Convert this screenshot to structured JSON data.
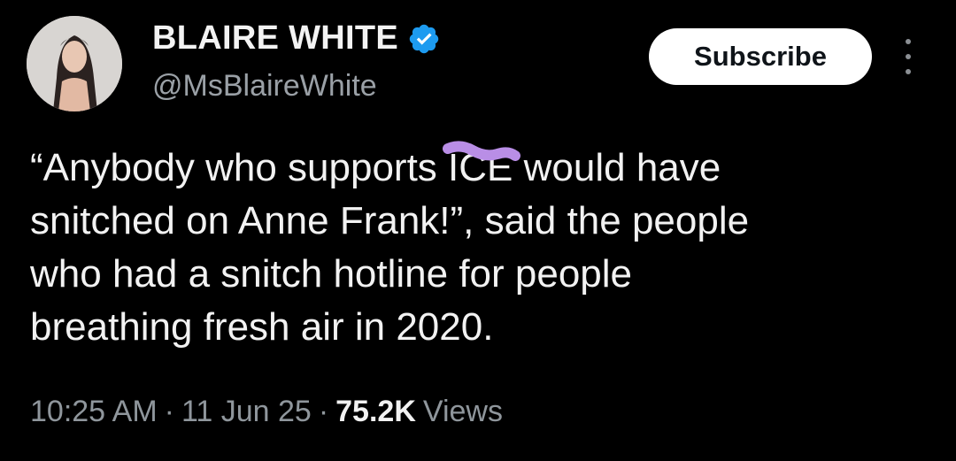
{
  "author": {
    "name": "BLAIRE WHITE",
    "handle": "@MsBlaireWhite",
    "verified": true
  },
  "actions": {
    "subscribe_label": "Subscribe",
    "more_icon": "more-vertical-icon"
  },
  "tweet": {
    "part1": "“Anybody who supports ",
    "redacted": "ICE",
    "part2": " would have\nsnitched on Anne Frank!”, said the people\nwho had a snitch hotline for people\nbreathing fresh air in 2020."
  },
  "meta": {
    "time": "10:25 AM",
    "separator": "·",
    "date": "11 Jun 25",
    "views_count": "75.2K",
    "views_label": "Views"
  },
  "colors": {
    "background": "#000000",
    "verified": "#1d9bf0",
    "scribble": "#b98ee6"
  }
}
